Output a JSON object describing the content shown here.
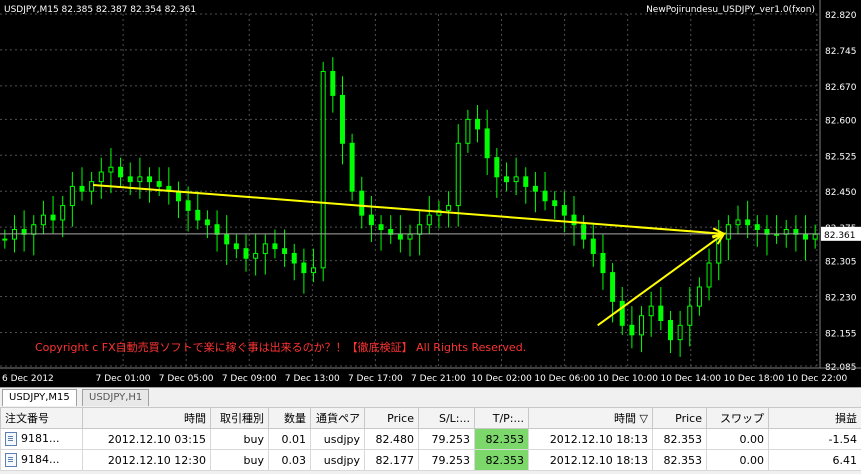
{
  "chart": {
    "symbol_info": "USDJPY,M15  82.385 82.387 82.354 82.361",
    "indicator_label": "NewPojirundesu_USDJPY_ver1.0(fxon)",
    "copyright": "Copyright c FX自動売買ソフトで楽に稼ぐ事は出来るのか？！【徹底検証】 All Rights Reserved.",
    "current_price": "82.361",
    "colors": {
      "background": "#000000",
      "candles": "#00ff00",
      "grid": "#505050",
      "arrow": "#ffff00",
      "copyright": "#ff3333"
    }
  },
  "chart_data": {
    "type": "candlestick",
    "y_ticks": [
      "82.820",
      "82.745",
      "82.670",
      "82.600",
      "82.525",
      "82.450",
      "82.375",
      "82.305",
      "82.230",
      "82.155",
      "82.085"
    ],
    "ylim": [
      82.085,
      82.82
    ],
    "x_ticks": [
      "6 Dec 2012",
      "7 Dec 01:00",
      "7 Dec 05:00",
      "7 Dec 09:00",
      "7 Dec 13:00",
      "7 Dec 17:00",
      "7 Dec 21:00",
      "10 Dec 02:00",
      "10 Dec 06:00",
      "10 Dec 10:00",
      "10 Dec 14:00",
      "10 Dec 18:00",
      "10 Dec 22:00"
    ],
    "close_series": [
      82.35,
      82.37,
      82.36,
      82.38,
      82.4,
      82.39,
      82.42,
      82.46,
      82.45,
      82.47,
      82.49,
      82.5,
      82.48,
      82.47,
      82.48,
      82.47,
      82.46,
      82.45,
      82.43,
      82.41,
      82.39,
      82.38,
      82.36,
      82.34,
      82.33,
      82.31,
      82.32,
      82.34,
      82.33,
      82.32,
      82.3,
      82.28,
      82.29,
      82.7,
      82.65,
      82.55,
      82.45,
      82.4,
      82.38,
      82.37,
      82.36,
      82.35,
      82.36,
      82.38,
      82.4,
      82.41,
      82.42,
      82.55,
      82.6,
      82.58,
      82.52,
      82.48,
      82.47,
      82.48,
      82.46,
      82.45,
      82.43,
      82.42,
      82.4,
      82.38,
      82.35,
      82.32,
      82.28,
      82.22,
      82.17,
      82.15,
      82.19,
      82.21,
      82.18,
      82.14,
      82.17,
      82.21,
      82.25,
      82.3,
      82.35,
      82.38,
      82.39,
      82.38,
      82.37,
      82.36,
      82.36,
      82.37,
      82.36,
      82.35,
      82.36
    ],
    "arrows": [
      {
        "from": [
          82.463,
          "7 Dec 01:00"
        ],
        "to": [
          82.361,
          "10 Dec 18:00"
        ]
      },
      {
        "from": [
          82.17,
          "10 Dec 10:00"
        ],
        "to": [
          82.361,
          "10 Dec 18:00"
        ]
      }
    ]
  },
  "tabs": [
    {
      "label": "USDJPY,M15"
    },
    {
      "label": "USDJPY,H1"
    }
  ],
  "table": {
    "headers": [
      "注文番号",
      "時間",
      "取引種別",
      "数量",
      "通貨ペア",
      "Price",
      "S/L:...",
      "T/P:...",
      "時間 ▽",
      "Price",
      "スワップ",
      "損益"
    ],
    "rows": [
      [
        "9181...",
        "2012.12.10 03:15",
        "buy",
        "0.01",
        "usdjpy",
        "82.480",
        "79.253",
        "82.353",
        "2012.12.10 18:13",
        "82.353",
        "0.00",
        "-1.54"
      ],
      [
        "9184...",
        "2012.12.10 12:30",
        "buy",
        "0.03",
        "usdjpy",
        "82.177",
        "79.253",
        "82.353",
        "2012.12.10 18:13",
        "82.353",
        "0.00",
        "6.41"
      ]
    ]
  }
}
